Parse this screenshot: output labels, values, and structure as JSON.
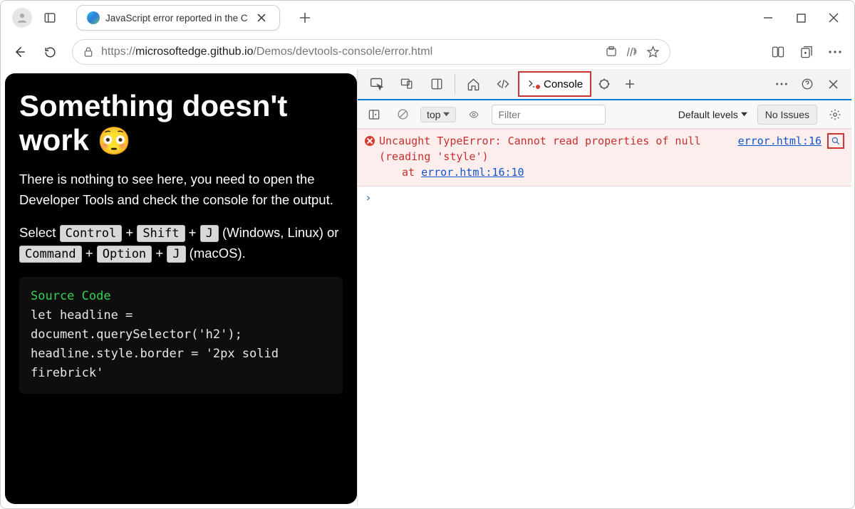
{
  "browser": {
    "tab_title": "JavaScript error reported in the C",
    "url_prefix": "https://",
    "url_host": "microsoftedge.github.io",
    "url_path": "/Demos/devtools-console/error.html"
  },
  "page": {
    "heading": "Something doesn't work",
    "emoji": "😳",
    "para1": "There is nothing to see here, you need to open the Developer Tools and check the console for the output.",
    "para2_pre": "Select ",
    "para2_mid": " (Windows, Linux) or ",
    "para2_end": " (macOS).",
    "keys": {
      "ctrl": "Control",
      "shift": "Shift",
      "j": "J",
      "cmd": "Command",
      "opt": "Option",
      "plus": "+"
    },
    "code_header": "Source Code",
    "code_l1": "let headline = document.querySelector('h2');",
    "code_l2": "headline.style.border = '2px solid firebrick'"
  },
  "devtools": {
    "tab_console": "Console",
    "context": "top",
    "filter_placeholder": "Filter",
    "levels_label": "Default levels",
    "no_issues": "No Issues",
    "error_message": "Uncaught TypeError: Cannot read properties of null (reading 'style')",
    "stack_prefix": "at ",
    "stack_link": "error.html:16:10",
    "source_link": "error.html:16",
    "prompt": "›"
  }
}
